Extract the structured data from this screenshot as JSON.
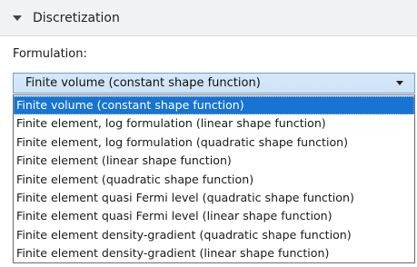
{
  "section": {
    "title": "Discretization"
  },
  "formulation": {
    "label": "Formulation:",
    "selected": "Finite volume (constant shape function)",
    "options": [
      "Finite volume (constant shape function)",
      "Finite element, log formulation (linear shape function)",
      "Finite element, log formulation (quadratic shape function)",
      "Finite element (linear shape function)",
      "Finite element (quadratic shape function)",
      "Finite element quasi Fermi level (quadratic shape function)",
      "Finite element quasi Fermi level (linear shape function)",
      "Finite element density-gradient (quadratic shape function)",
      "Finite element density-gradient (linear shape function)"
    ],
    "highlighted_index": 0
  },
  "colors": {
    "highlight": "#1874d2",
    "combo_fill": "#d6e8fa",
    "header_bg": "#f1f2f3"
  }
}
